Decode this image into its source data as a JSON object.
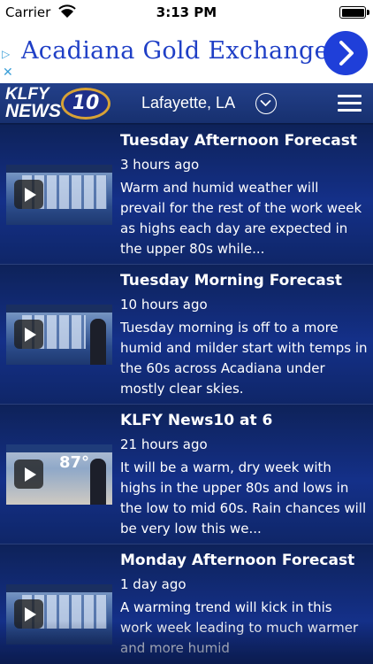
{
  "status_bar": {
    "carrier": "Carrier",
    "time": "3:13 PM",
    "icons": [
      "wifi-icon",
      "battery-icon"
    ]
  },
  "ad": {
    "text": "Acadiana Gold Exchange",
    "choice_glyph": "▷",
    "close_glyph": "✕",
    "arrow_icon": "chevron-right-icon",
    "text_color": "#1f3fc6",
    "button_color": "#1f3fd9"
  },
  "header": {
    "logo": {
      "text_top": "KLFY",
      "text_bottom": "NEWS",
      "badge": "10"
    },
    "location": "Lafayette, LA",
    "icons": [
      "chevron-down-circle-icon",
      "hamburger-menu-icon"
    ],
    "background": "#1c3a80"
  },
  "feed": {
    "items": [
      {
        "title": "Tuesday Afternoon Forecast",
        "time": "3 hours ago",
        "description": "Warm and humid weather will prevail for the rest of the work week as highs each day are expected in the upper 80s while...",
        "thumbnail_icon": "play-icon"
      },
      {
        "title": "Tuesday Morning Forecast",
        "time": "10 hours ago",
        "description": "Tuesday morning is off to a more humid and milder start with temps in the 60s across Acadiana under mostly clear skies.",
        "thumbnail_icon": "play-icon"
      },
      {
        "title": "KLFY News10 at 6",
        "time": "21 hours ago",
        "description": "It will be a warm, dry week with highs in the upper 80s and lows in the low to mid 60s. Rain chances will be very low this we...",
        "thumbnail_icon": "play-icon",
        "thumbnail_temp": "87°"
      },
      {
        "title": "Monday Afternoon Forecast",
        "time": "1 day ago",
        "description": "A warming trend will kick in this work week leading to much warmer and more humid",
        "thumbnail_icon": "play-icon"
      }
    ]
  }
}
